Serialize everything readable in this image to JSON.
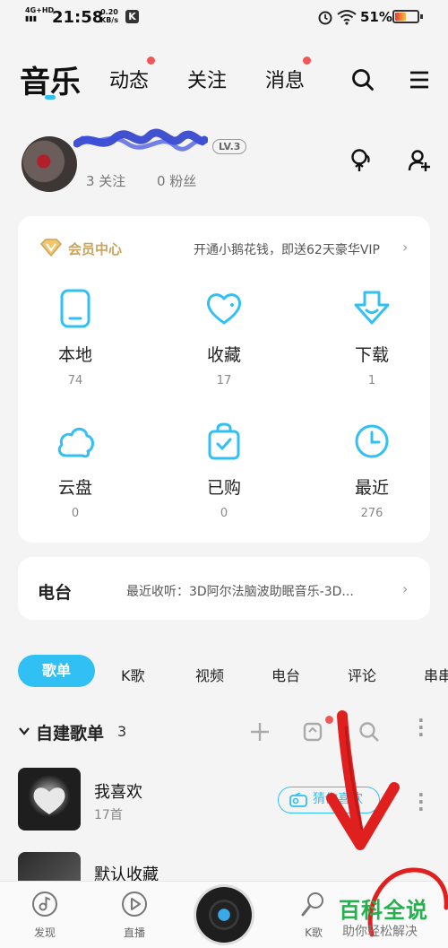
{
  "status_bar": {
    "network": "4G+HD",
    "time": "21:58",
    "speed_value": "0.20",
    "speed_unit": "KB/s",
    "app_badge": "K",
    "battery_pct": "51%",
    "battery_level": 0.51
  },
  "top_nav": {
    "tabs": [
      {
        "label": "音乐",
        "active": true,
        "badge": false
      },
      {
        "label": "动态",
        "active": false,
        "badge": true
      },
      {
        "label": "关注",
        "active": false,
        "badge": false
      },
      {
        "label": "消息",
        "active": false,
        "badge": true
      }
    ]
  },
  "profile": {
    "level": "LV.3",
    "following": "3 关注",
    "fans": "0 粉丝"
  },
  "vip": {
    "title": "会员中心",
    "promo": "开通小鹅花钱，即送62天豪华VIP"
  },
  "library": [
    {
      "label": "本地",
      "count": "74",
      "icon": "phone-icon"
    },
    {
      "label": "收藏",
      "count": "17",
      "icon": "heart-icon"
    },
    {
      "label": "下载",
      "count": "1",
      "icon": "download-icon"
    },
    {
      "label": "云盘",
      "count": "0",
      "icon": "cloud-icon"
    },
    {
      "label": "已购",
      "count": "0",
      "icon": "shopping-bag-icon"
    },
    {
      "label": "最近",
      "count": "276",
      "icon": "clock-icon"
    }
  ],
  "radio": {
    "title": "电台",
    "recent": "最近收听：3D阿尔法脑波助眠音乐-3D..."
  },
  "sub_tabs": [
    "歌单",
    "K歌",
    "视频",
    "电台",
    "评论",
    "串串"
  ],
  "playlists": {
    "heading": "自建歌单",
    "count": "3",
    "items": [
      {
        "title": "我喜欢",
        "subtitle": "17首"
      },
      {
        "title": "默认收藏",
        "subtitle": ""
      }
    ],
    "guess_label": "猜你喜欢"
  },
  "bottom_nav": [
    {
      "label": "发现",
      "icon": "music-note-icon"
    },
    {
      "label": "直播",
      "icon": "play-circle-icon"
    },
    {
      "label": "K歌",
      "icon": "microphone-icon"
    }
  ],
  "watermark": {
    "title": "百科全说",
    "subtitle": "助你轻松解决"
  },
  "colors": {
    "accent": "#31c0f4",
    "badge": "#f25757",
    "vip_gold": "#c9a45b",
    "annotation_red": "#e0201e"
  }
}
